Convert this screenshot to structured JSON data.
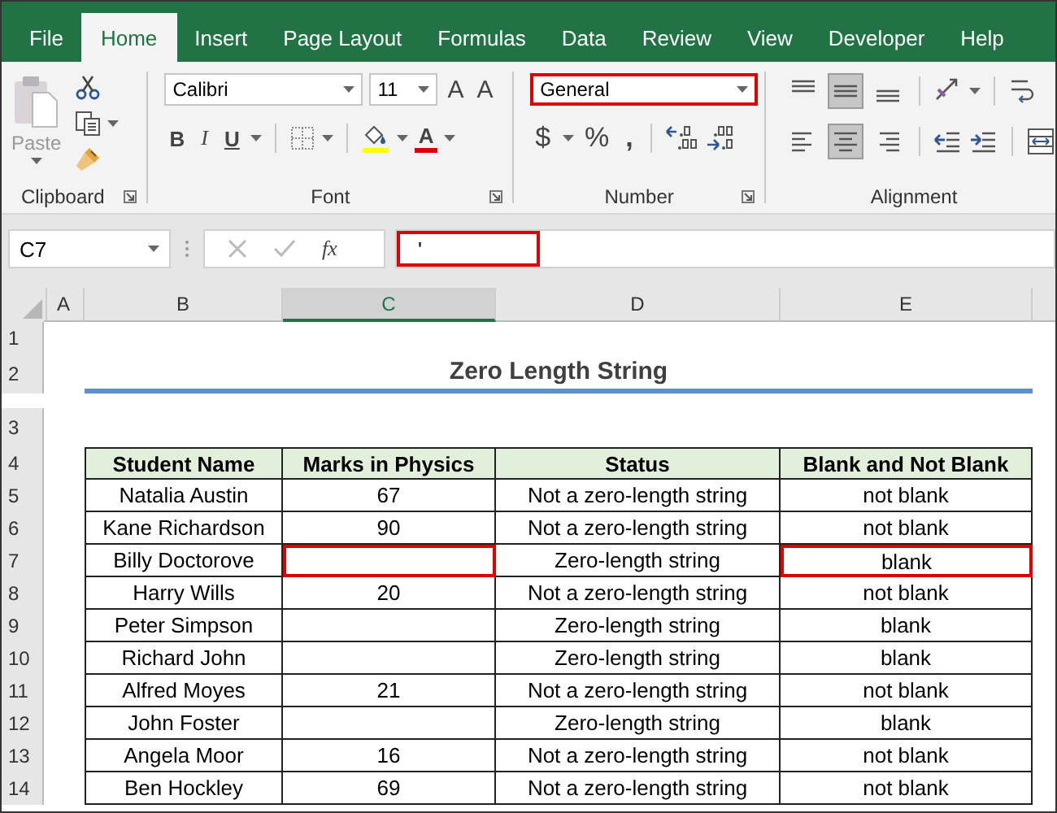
{
  "tabs": [
    {
      "label": "File",
      "selected": false
    },
    {
      "label": "Home",
      "selected": true
    },
    {
      "label": "Insert",
      "selected": false
    },
    {
      "label": "Page Layout",
      "selected": false
    },
    {
      "label": "Formulas",
      "selected": false
    },
    {
      "label": "Data",
      "selected": false
    },
    {
      "label": "Review",
      "selected": false
    },
    {
      "label": "View",
      "selected": false
    },
    {
      "label": "Developer",
      "selected": false
    },
    {
      "label": "Help",
      "selected": false
    }
  ],
  "ribbon": {
    "clipboard": {
      "paste_label": "Paste",
      "label": "Clipboard"
    },
    "font": {
      "font_name": "Calibri",
      "font_size": "11",
      "grow": "A",
      "shrink": "A",
      "bold": "B",
      "italic": "I",
      "underline": "U",
      "font_color": "A",
      "label": "Font"
    },
    "number": {
      "format": "General",
      "highlighted": true,
      "currency": "$",
      "percent": "%",
      "comma": ",",
      "label": "Number"
    },
    "alignment": {
      "label": "Alignment",
      "vertical": [
        {
          "kind": "top",
          "pressed": false
        },
        {
          "kind": "middle",
          "pressed": true
        },
        {
          "kind": "bottom",
          "pressed": false
        }
      ],
      "horizontal": [
        {
          "kind": "left",
          "pressed": false
        },
        {
          "kind": "center",
          "pressed": true
        },
        {
          "kind": "right",
          "pressed": false
        }
      ]
    }
  },
  "formula_bar": {
    "name_box": "C7",
    "fx": "fx",
    "value": "'",
    "highlighted": true
  },
  "sheet": {
    "columns": [
      {
        "label": "A",
        "selected": false
      },
      {
        "label": "B",
        "selected": false
      },
      {
        "label": "C",
        "selected": true
      },
      {
        "label": "D",
        "selected": false
      },
      {
        "label": "E",
        "selected": false
      }
    ],
    "rows": [
      "1",
      "2",
      "3",
      "4",
      "5",
      "6",
      "7",
      "8",
      "9",
      "10",
      "11",
      "12",
      "13",
      "14"
    ],
    "title": "Zero Length String",
    "table": {
      "columns": [
        "Student Name",
        "Marks in Physics",
        "Status",
        "Blank and Not Blank"
      ],
      "rows": [
        {
          "cells": [
            {
              "text": "Natalia Austin",
              "highlighted": false
            },
            {
              "text": "67",
              "highlighted": false
            },
            {
              "text": "Not a zero-length string",
              "highlighted": false
            },
            {
              "text": "not blank",
              "highlighted": false
            }
          ]
        },
        {
          "cells": [
            {
              "text": "Kane Richardson",
              "highlighted": false
            },
            {
              "text": "90",
              "highlighted": false
            },
            {
              "text": "Not a zero-length string",
              "highlighted": false
            },
            {
              "text": "not blank",
              "highlighted": false
            }
          ]
        },
        {
          "cells": [
            {
              "text": "Billy Doctorove",
              "highlighted": false
            },
            {
              "highlighted": true
            },
            {
              "text": "Zero-length string",
              "highlighted": false
            },
            {
              "text": "blank",
              "highlighted": true
            }
          ]
        },
        {
          "cells": [
            {
              "text": "Harry Wills",
              "highlighted": false
            },
            {
              "text": "20",
              "highlighted": false
            },
            {
              "text": "Not a zero-length string",
              "highlighted": false
            },
            {
              "text": "not blank",
              "highlighted": false
            }
          ]
        },
        {
          "cells": [
            {
              "text": "Peter Simpson",
              "highlighted": false
            },
            {
              "highlighted": false
            },
            {
              "text": "Zero-length string",
              "highlighted": false
            },
            {
              "text": "blank",
              "highlighted": false
            }
          ]
        },
        {
          "cells": [
            {
              "text": "Richard John",
              "highlighted": false
            },
            {
              "highlighted": false
            },
            {
              "text": "Zero-length string",
              "highlighted": false
            },
            {
              "text": "blank",
              "highlighted": false
            }
          ]
        },
        {
          "cells": [
            {
              "text": "Alfred Moyes",
              "highlighted": false
            },
            {
              "text": "21",
              "highlighted": false
            },
            {
              "text": "Not a zero-length string",
              "highlighted": false
            },
            {
              "text": "not blank",
              "highlighted": false
            }
          ]
        },
        {
          "cells": [
            {
              "text": "John Foster",
              "highlighted": false
            },
            {
              "highlighted": false
            },
            {
              "text": "Zero-length string",
              "highlighted": false
            },
            {
              "text": "blank",
              "highlighted": false
            }
          ]
        },
        {
          "cells": [
            {
              "text": "Angela Moor",
              "highlighted": false
            },
            {
              "text": "16",
              "highlighted": false
            },
            {
              "text": "Not a zero-length string",
              "highlighted": false
            },
            {
              "text": "not blank",
              "highlighted": false
            }
          ]
        },
        {
          "cells": [
            {
              "text": "Ben Hockley",
              "highlighted": false
            },
            {
              "text": "69",
              "highlighted": false
            },
            {
              "text": "Not a zero-length string",
              "highlighted": false
            },
            {
              "text": "not blank",
              "highlighted": false
            }
          ]
        }
      ]
    }
  }
}
